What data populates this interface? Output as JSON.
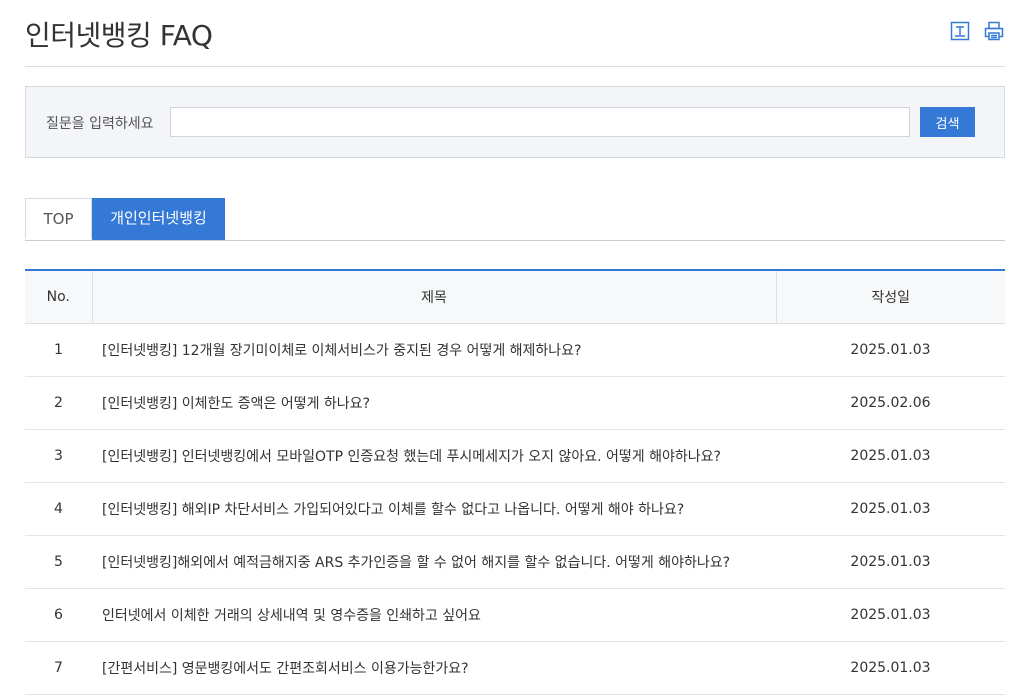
{
  "header": {
    "title": "인터넷뱅킹 FAQ",
    "icons": [
      "download-icon",
      "print-icon"
    ]
  },
  "search": {
    "label": "질문을 입력하세요",
    "value": "",
    "placeholder": "",
    "button_label": "검색"
  },
  "tabs": [
    {
      "label": "TOP",
      "active": false
    },
    {
      "label": "개인인터넷뱅킹",
      "active": true
    }
  ],
  "colors": {
    "accent": "#3479d6"
  },
  "table": {
    "headers": {
      "no": "No.",
      "title": "제목",
      "date": "작성일"
    },
    "rows": [
      {
        "no": "1",
        "title": "[인터넷뱅킹] 12개월 장기미이체로 이체서비스가 중지된 경우 어떻게 해제하나요?",
        "date": "2025.01.03"
      },
      {
        "no": "2",
        "title": "[인터넷뱅킹] 이체한도 증액은 어떻게 하나요?",
        "date": "2025.02.06"
      },
      {
        "no": "3",
        "title": "[인터넷뱅킹] 인터넷뱅킹에서 모바일OTP 인증요청 했는데 푸시메세지가 오지 않아요. 어떻게 해야하나요?",
        "date": "2025.01.03"
      },
      {
        "no": "4",
        "title": "[인터넷뱅킹] 해외IP 차단서비스 가입되어있다고 이체를 할수 없다고 나옵니다. 어떻게 해야 하나요?",
        "date": "2025.01.03"
      },
      {
        "no": "5",
        "title": "[인터넷뱅킹]해외에서 예적금해지중 ARS 추가인증을 할 수 없어 해지를 할수 없습니다. 어떻게 해야하나요?",
        "date": "2025.01.03"
      },
      {
        "no": "6",
        "title": "인터넷에서 이체한 거래의 상세내역 및 영수증을 인쇄하고 싶어요",
        "date": "2025.01.03"
      },
      {
        "no": "7",
        "title": "[간편서비스] 영문뱅킹에서도 간편조회서비스 이용가능한가요?",
        "date": "2025.01.03"
      }
    ]
  }
}
